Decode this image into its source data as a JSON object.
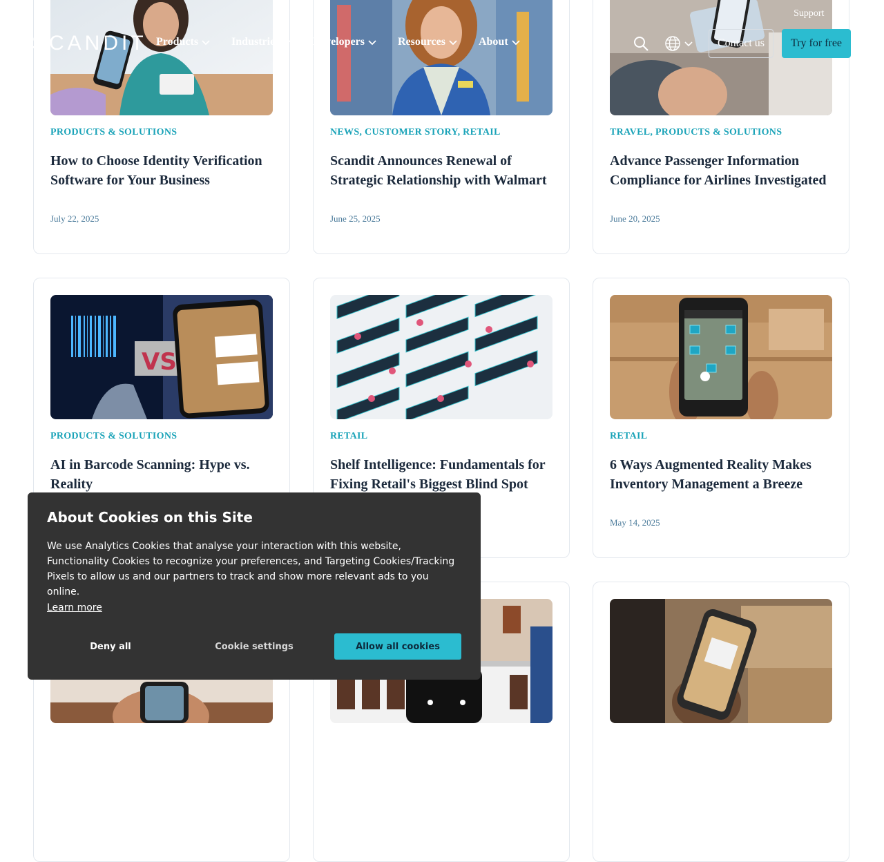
{
  "header": {
    "logo": "SCANDIT",
    "nav": [
      "Products",
      "Industries",
      "Developers",
      "Resources",
      "About"
    ],
    "top_links": [
      "Support",
      "L"
    ],
    "contact_label": "Contact us",
    "try_label": "Try for free"
  },
  "cards": [
    {
      "category": "PRODUCTS & SOLUTIONS",
      "title": "How to Choose Identity Verification Software for Your Business",
      "date": "July 22, 2025",
      "image": "person-verifying-id-on-phone"
    },
    {
      "category": "NEWS, CUSTOMER STORY, RETAIL",
      "title": "Scandit Announces Renewal of Strategic Relationship with Walmart",
      "date": "June 25, 2025",
      "image": "walmart-associate-portrait"
    },
    {
      "category": "TRAVEL, PRODUCTS & SOLUTIONS",
      "title": "Advance Passenger Information Compliance for Airlines Investigated",
      "date": "June 20, 2025",
      "image": "passport-scan-on-phone"
    },
    {
      "category": "PRODUCTS & SOLUTIONS",
      "title": "AI in Barcode Scanning: Hype vs. Reality",
      "date": "",
      "image": "barcode-vs-list-building"
    },
    {
      "category": "RETAIL",
      "title": "Shelf Intelligence: Fundamentals for Fixing Retail's Biggest Blind Spot",
      "date": "",
      "image": "isometric-shelf-grid"
    },
    {
      "category": "RETAIL",
      "title": "6 Ways Augmented Reality Makes Inventory Management a Breeze",
      "date": "May 14, 2025",
      "image": "phone-batch-inventory-scan"
    },
    {
      "category": "",
      "title": "",
      "date": "",
      "image": "hand-holding-phone"
    },
    {
      "category": "",
      "title": "",
      "date": "",
      "image": "store-shelf-scanning"
    },
    {
      "category": "",
      "title": "",
      "date": "",
      "image": "warehouse-package-scan"
    }
  ],
  "cookie": {
    "title": "About Cookies on this Site",
    "body": "We use Analytics Cookies that analyse your interaction with this website, Functionality Cookies to recognize your preferences, and Targeting Cookies/Tracking Pixels to allow us and our partners to track and show more relevant ads to you online.",
    "learn_more": "Learn more",
    "deny": "Deny all",
    "settings": "Cookie settings",
    "allow": "Allow all cookies"
  },
  "colors": {
    "accent": "#2bbcd0",
    "category": "#1aa3b8",
    "date": "#4a7a9a",
    "banner": "#333333"
  }
}
